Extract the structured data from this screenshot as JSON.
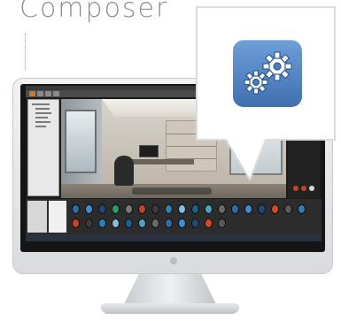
{
  "header": {
    "title": "Composer"
  },
  "monitor": {
    "screen": {
      "palette": [
        "#2f6da3",
        "#3f8fd0",
        "#1f4a7a",
        "#2a9d6a",
        "#7a7a7a",
        "#c1452b",
        "#3b3b3b",
        "#2e7fb8",
        "#8bbbe0",
        "#1c5f8a",
        "#4aa3c7",
        "#6b6b6b",
        "#2f6da3",
        "#3f8fd0",
        "#1f4a7a",
        "#d04b2a",
        "#5a5a5a",
        "#2e7fb8"
      ]
    }
  },
  "callout": {
    "icon": "gear-icon",
    "accent": "#4a7cc0"
  }
}
